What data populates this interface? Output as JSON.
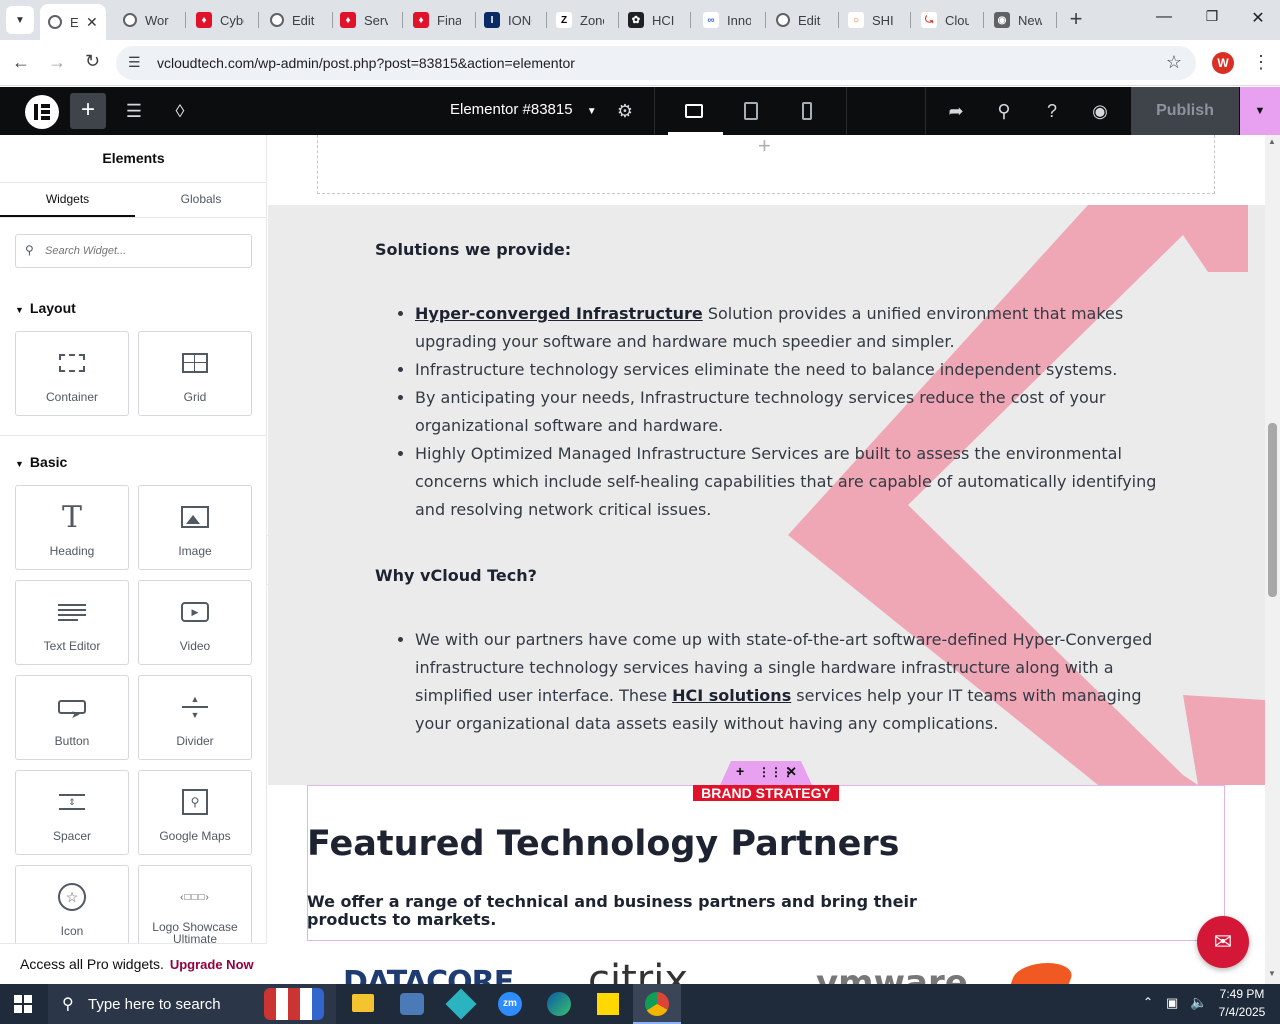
{
  "browser": {
    "tabs": [
      {
        "title": "E",
        "icon": "wordpress-icon",
        "active": true
      },
      {
        "title": "Wor",
        "icon": "wordpress-icon"
      },
      {
        "title": "Cybe",
        "icon": "red-diamond-icon"
      },
      {
        "title": "Edit",
        "icon": "wordpress-icon"
      },
      {
        "title": "Serv",
        "icon": "red-diamond-icon"
      },
      {
        "title": "Finar",
        "icon": "red-diamond-icon"
      },
      {
        "title": "IONC",
        "icon": "ionos-icon"
      },
      {
        "title": "Zone",
        "icon": "z-icon"
      },
      {
        "title": "HCI S",
        "icon": "openai-icon"
      },
      {
        "title": "Inno",
        "icon": "semrush-icon"
      },
      {
        "title": "Edit",
        "icon": "wordpress-icon"
      },
      {
        "title": "SHI |",
        "icon": "shi-icon"
      },
      {
        "title": "Clou",
        "icon": "red-swoosh-icon"
      },
      {
        "title": "New",
        "icon": "chrome-icon"
      }
    ],
    "url": "vcloudtech.com/wp-admin/post.php?post=83815&action=elementor",
    "profile_initial": "W"
  },
  "elementor": {
    "document_title": "Elementor #83815",
    "publish_label": "Publish"
  },
  "panel": {
    "title": "Elements",
    "tabs": [
      "Widgets",
      "Globals"
    ],
    "search_placeholder": "Search Widget...",
    "sections": {
      "layout": "Layout",
      "basic": "Basic"
    },
    "layout_widgets": [
      "Container",
      "Grid"
    ],
    "basic_widgets": [
      "Heading",
      "Image",
      "Text Editor",
      "Video",
      "Button",
      "Divider",
      "Spacer",
      "Google Maps",
      "Icon",
      "Logo Showcase Ultimate"
    ],
    "pro_notice": "Access all Pro widgets.",
    "upgrade_label": "Upgrade Now"
  },
  "content": {
    "solutions_heading": "Solutions we provide:",
    "bullet1_link": "Hyper-converged Infrastructure",
    "bullet1_rest": " Solution provides a unified environment that makes upgrading your software and hardware much speedier and simpler.",
    "bullet2": "Infrastructure technology services eliminate the need to balance independent systems.",
    "bullet3": "By anticipating your needs, Infrastructure technology services reduce the cost of your organizational software and hardware.",
    "bullet4": "Highly Optimized Managed Infrastructure Services are built to assess the environmental concerns which include self-healing capabilities that are capable of automatically identifying and resolving network critical issues.",
    "why_heading": "Why vCloud Tech?",
    "why_pre": "We with our partners have come up with state-of-the-art software-defined Hyper-Converged infrastructure technology services having a single hardware infrastructure along with a simplified user interface. These ",
    "why_link": "HCI solutions",
    "why_post": " services help your IT teams with managing your organizational data assets easily without having any complications.",
    "badge": "BRAND STRATEGY",
    "featured_title": "Featured Technology Partners",
    "featured_sub": "We offer a range of technical and business partners and bring their products to markets.",
    "logos": [
      "DATACORE",
      "citrix",
      "vmware"
    ]
  },
  "taskbar": {
    "search_placeholder": "Type here to search",
    "time": "7:49 PM",
    "date": "7/4/2025"
  },
  "colors": {
    "elementor_bar": "#0c0d0e",
    "publish_bg": "#3f444b",
    "accent_pink": "#f0a0b0",
    "badge_red": "#e1132a",
    "section_bg": "#ebebeb",
    "chat_red": "#d41736"
  }
}
